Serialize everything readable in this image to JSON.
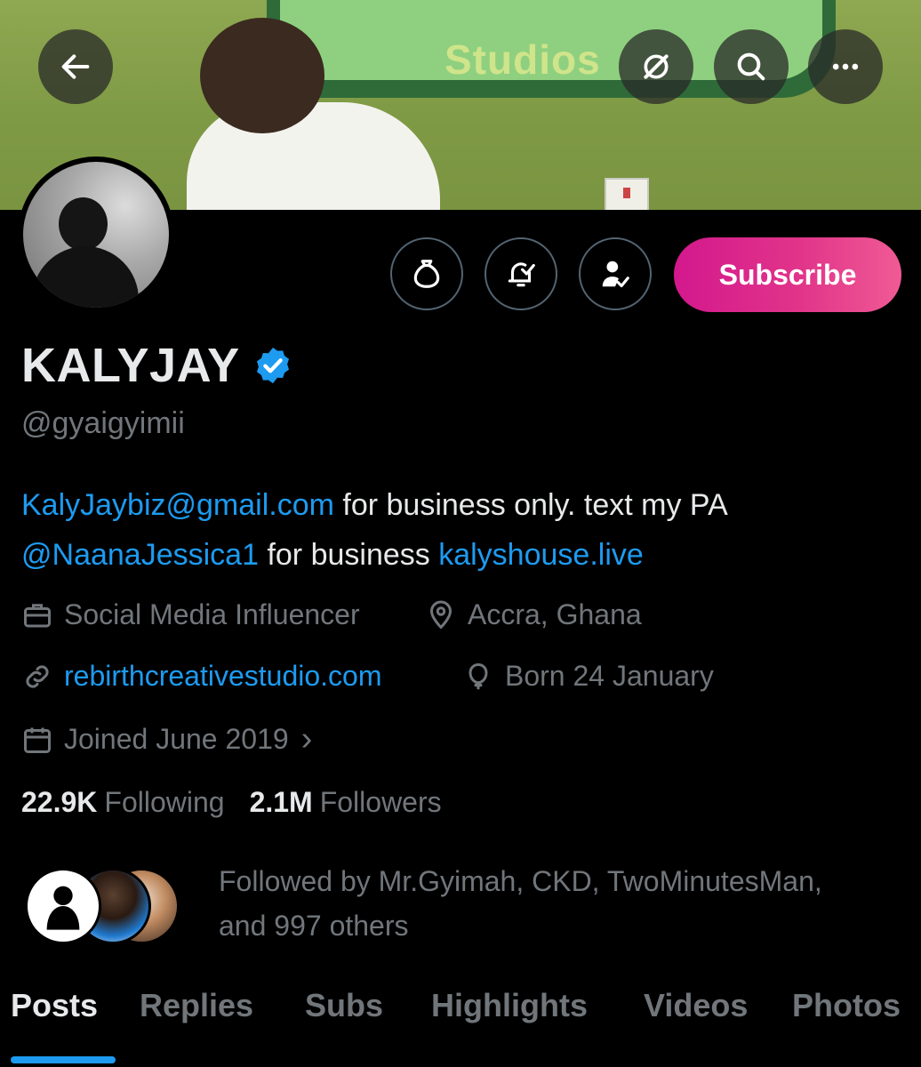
{
  "banner": {
    "sign_text": "Studios",
    "back_icon": "arrow-left-icon",
    "grok_icon": "grok-icon",
    "search_icon": "search-icon",
    "more_icon": "more-horizontal-icon"
  },
  "actions": {
    "tip_icon": "money-bag-icon",
    "notify_icon": "bell-check-icon",
    "follow_icon": "person-check-icon",
    "subscribe_label": "Subscribe"
  },
  "profile": {
    "name": "KALYJAY",
    "handle": "@gyaigyimii",
    "bio": {
      "email": "KalyJaybiz@gmail.com",
      "text1": " for business only. text my PA",
      "mention": "@NaanaJessica1",
      "text2": " for business ",
      "site": "kalyshouse.live"
    },
    "category": "Social Media Influencer",
    "location": "Accra, Ghana",
    "website": "rebirthcreativestudio.com",
    "birthday": "Born 24 January",
    "joined": "Joined June 2019",
    "joined_chevron": "›"
  },
  "stats": {
    "following_count": "22.9K",
    "following_label": "Following",
    "followers_count": "2.1M",
    "followers_label": "Followers"
  },
  "followed_by": {
    "line1": "Followed by Mr.Gyimah, CKD, TwoMinutesMan,",
    "line2": "and 997 others"
  },
  "tabs": [
    "Posts",
    "Replies",
    "Subs",
    "Highlights",
    "Videos",
    "Photos"
  ],
  "colors": {
    "link": "#1d9bf0",
    "subscribe_start": "#d3188d",
    "subscribe_end": "#f05a95",
    "muted": "#71767b"
  }
}
